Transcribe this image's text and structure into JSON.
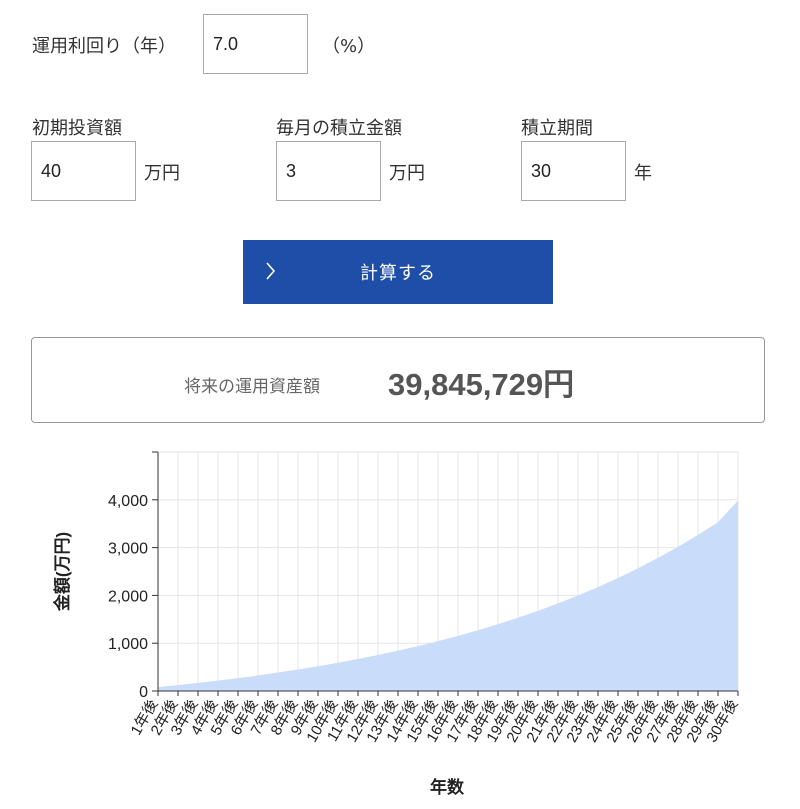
{
  "form": {
    "rate_label": "運用利回り（年）",
    "rate_value": "7.0",
    "rate_unit": "（%）",
    "initial_label": "初期投資額",
    "initial_value": "40",
    "initial_unit": "万円",
    "monthly_label": "毎月の積立金額",
    "monthly_value": "3",
    "monthly_unit": "万円",
    "period_label": "積立期間",
    "period_value": "30",
    "period_unit": "年",
    "calc_button": "計算する"
  },
  "result": {
    "label": "将来の運用資産額",
    "value": "39,845,729円"
  },
  "colors": {
    "button": "#1f4ea8",
    "area_fill": "#c9dcf9"
  },
  "chart_data": {
    "type": "area",
    "xlabel": "年数",
    "ylabel": "金額(万円)",
    "ylim": [
      0,
      5000
    ],
    "yticks": [
      0,
      1000,
      2000,
      3000,
      4000
    ],
    "ytick_labels": [
      "0",
      "1,000",
      "2,000",
      "3,000",
      "4,000"
    ],
    "grid": true,
    "categories": [
      "1年後",
      "2年後",
      "3年後",
      "4年後",
      "5年後",
      "6年後",
      "7年後",
      "8年後",
      "9年後",
      "10年後",
      "11年後",
      "12年後",
      "13年後",
      "14年後",
      "15年後",
      "16年後",
      "17年後",
      "18年後",
      "19年後",
      "20年後",
      "21年後",
      "22年後",
      "23年後",
      "24年後",
      "25年後",
      "26年後",
      "27年後",
      "28年後",
      "29年後",
      "30年後"
    ],
    "values": [
      80,
      123,
      169,
      218,
      270,
      326,
      386,
      450,
      519,
      592,
      670,
      754,
      844,
      940,
      1043,
      1153,
      1271,
      1397,
      1532,
      1677,
      1832,
      1997,
      2174,
      2364,
      2567,
      2784,
      3016,
      3265,
      3531,
      3985
    ]
  }
}
